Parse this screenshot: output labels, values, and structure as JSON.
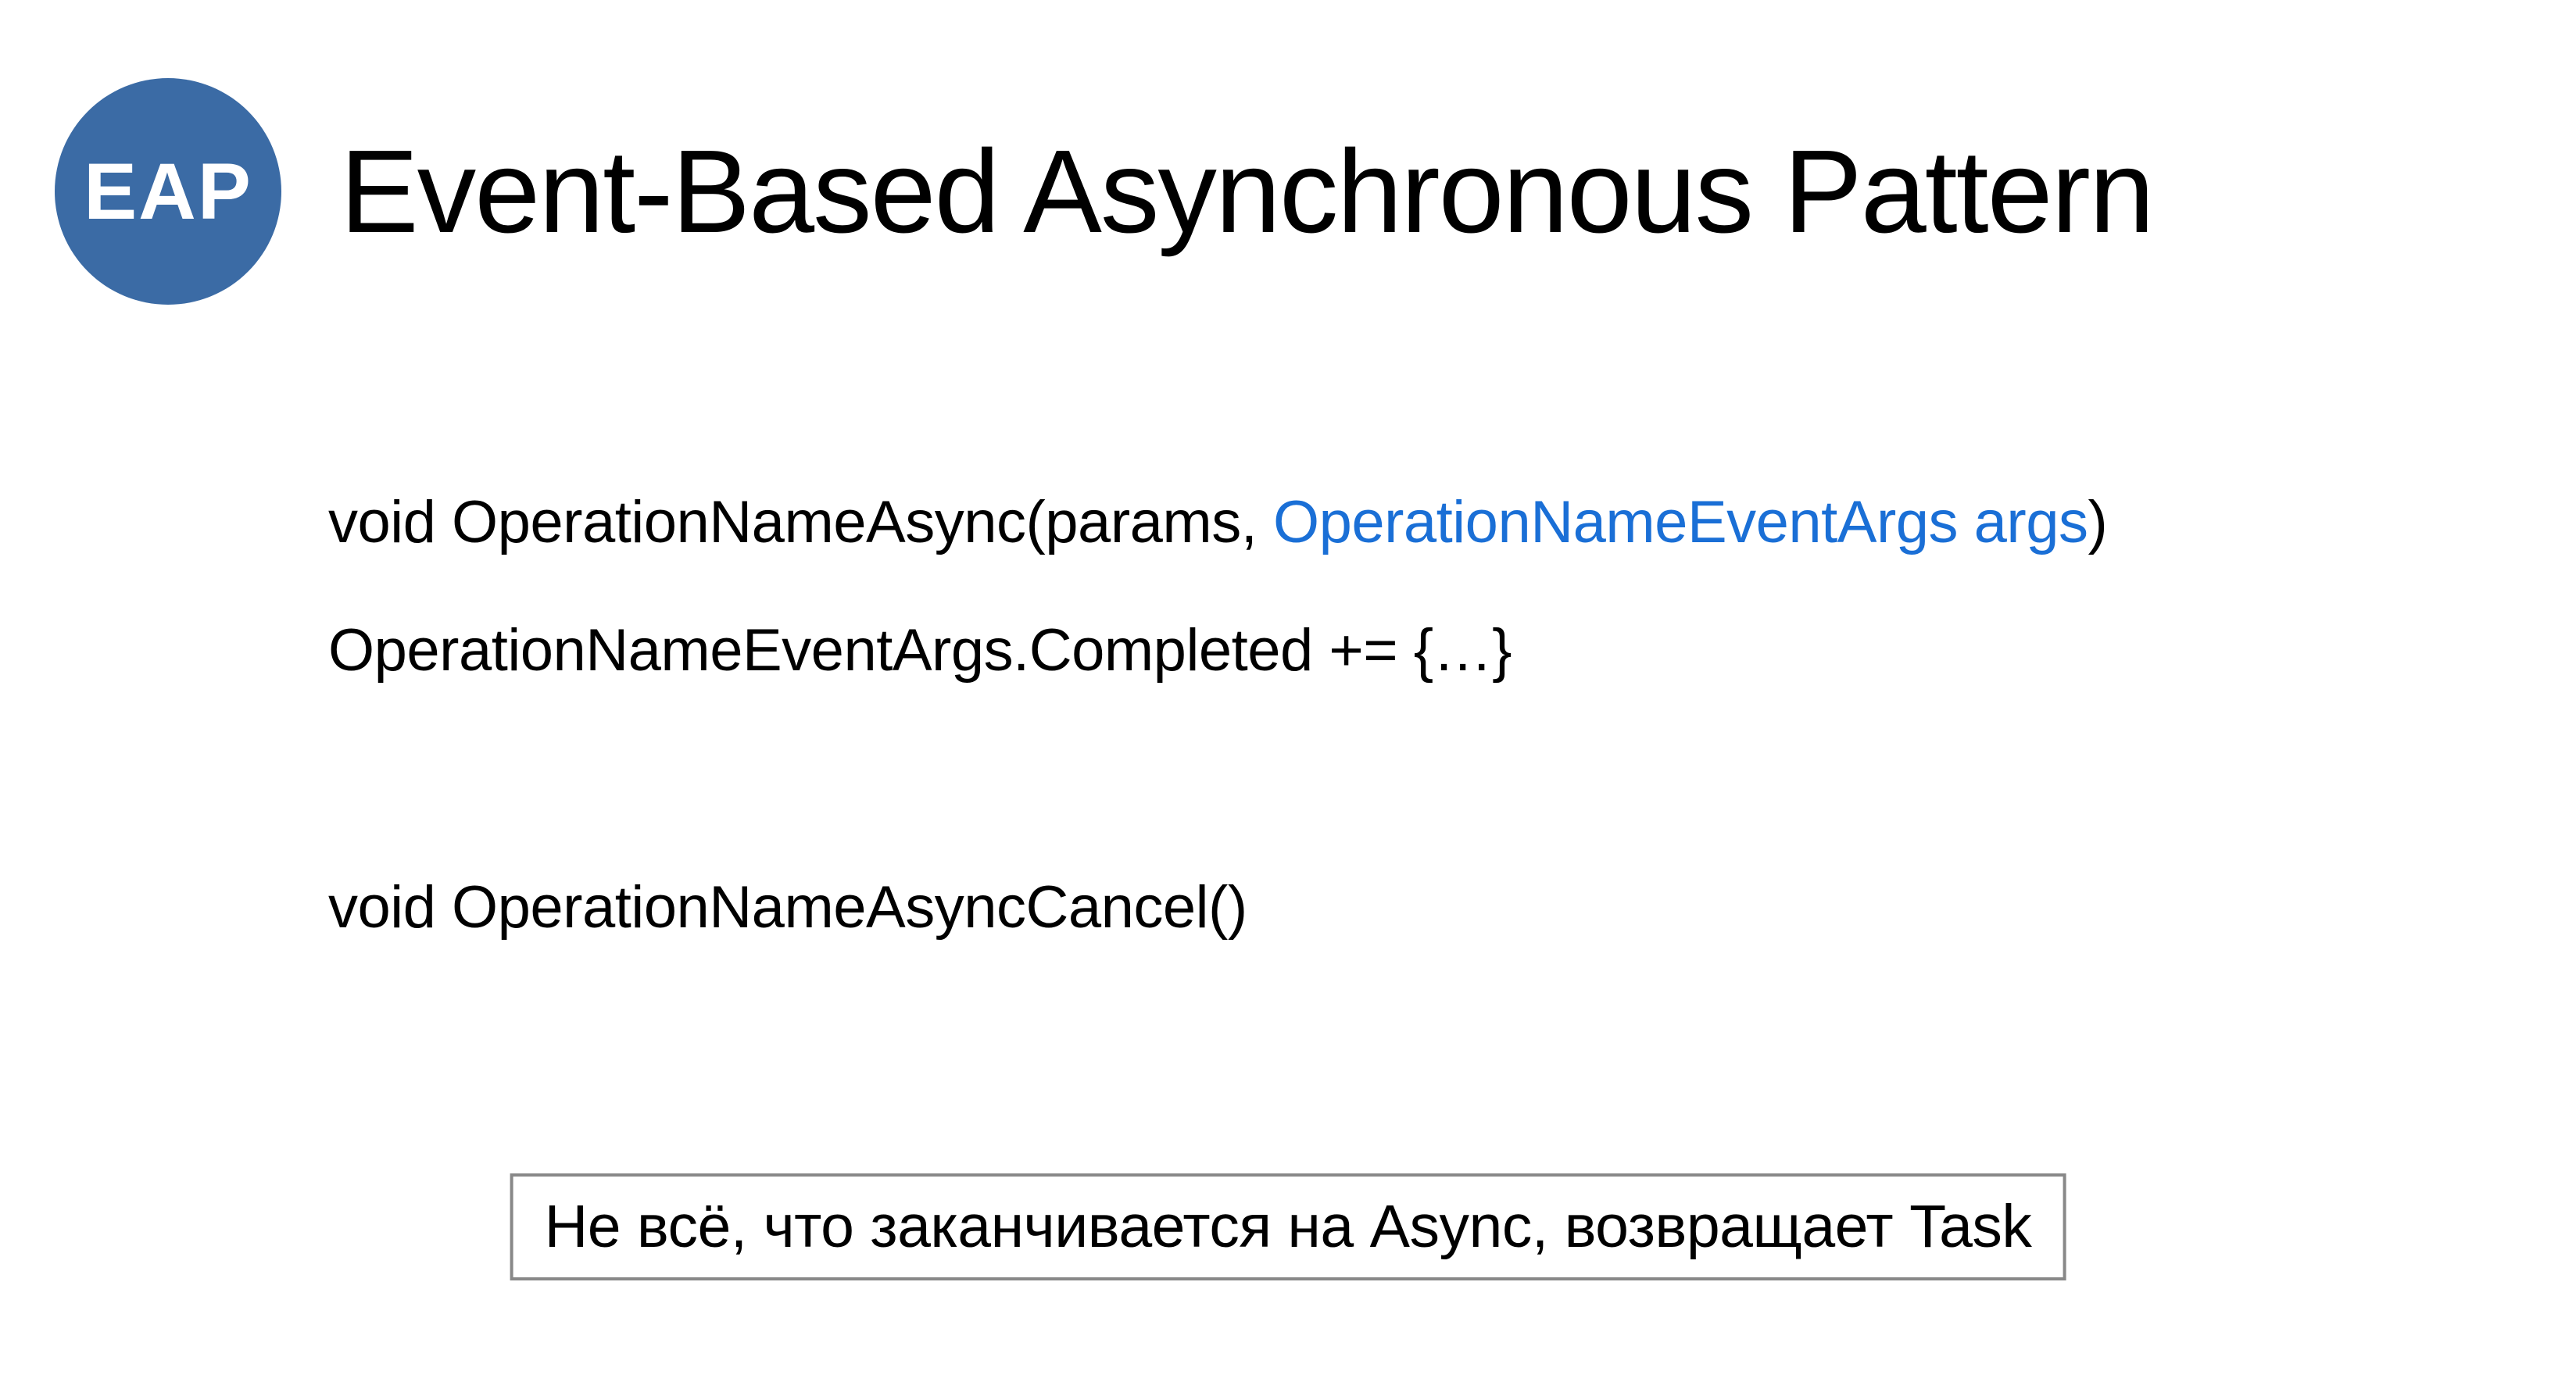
{
  "badge": {
    "text": "EAP",
    "background": "#3b6ba5"
  },
  "title": "Event-Based Asynchronous Pattern",
  "code": {
    "line1_prefix": "void OperationNameAsync(params, ",
    "line1_highlight": "OperationNameEventArgs args",
    "line1_suffix": ")",
    "line2": "OperationNameEventArgs.Completed += {…}",
    "line3": "void OperationNameAsyncCancel()"
  },
  "footer": {
    "note": "Не всё, что заканчивается на Async, возвращает Task"
  },
  "colors": {
    "highlight": "#1a6fd6",
    "badge_bg": "#3b6ba5",
    "border": "#888888"
  }
}
